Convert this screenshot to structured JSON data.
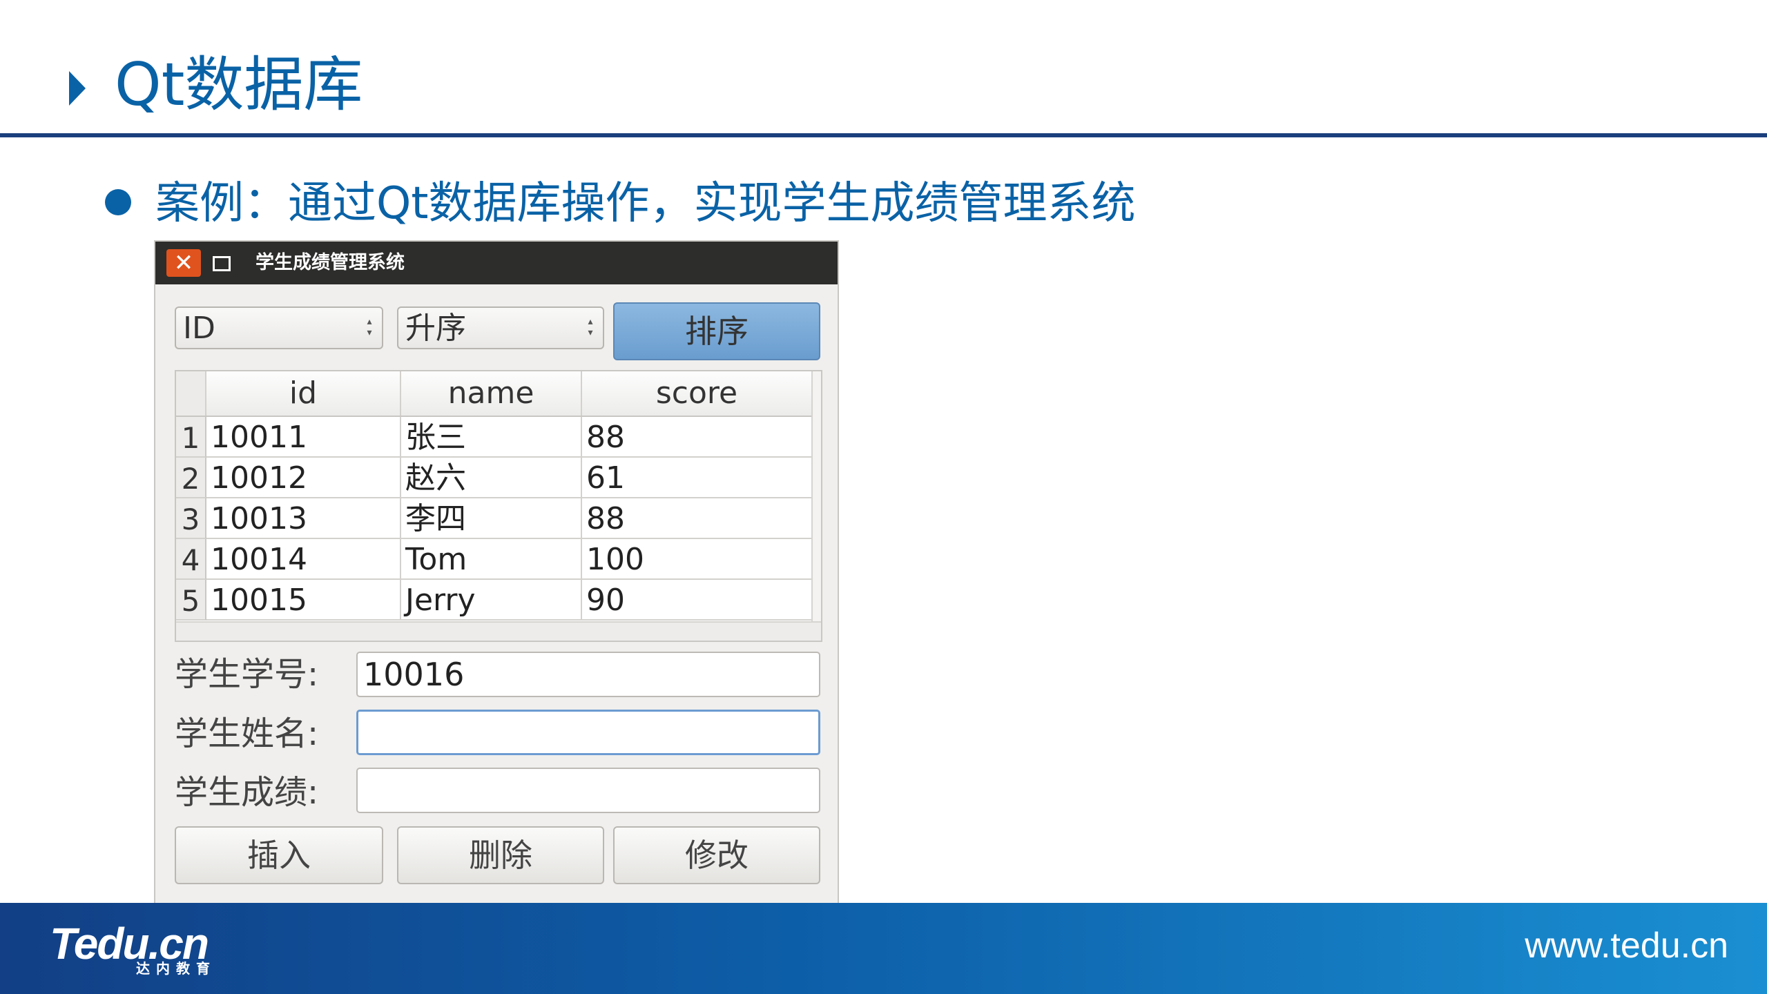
{
  "slide": {
    "title": "Qt数据库",
    "bullet": "案例：通过Qt数据库操作，实现学生成绩管理系统"
  },
  "window": {
    "title": "学生成绩管理系统",
    "close_glyph": "✕",
    "sort_field": "ID",
    "sort_order": "升序",
    "sort_button": "排序",
    "table": {
      "columns": [
        "id",
        "name",
        "score"
      ],
      "rows": [
        {
          "num": "1",
          "id": "10011",
          "name": "张三",
          "score": "88"
        },
        {
          "num": "2",
          "id": "10012",
          "name": "赵六",
          "score": "61"
        },
        {
          "num": "3",
          "id": "10013",
          "name": "李四",
          "score": "88"
        },
        {
          "num": "4",
          "id": "10014",
          "name": "Tom",
          "score": "100"
        },
        {
          "num": "5",
          "id": "10015",
          "name": "Jerry",
          "score": "90"
        }
      ]
    },
    "form": {
      "id_label": "学生学号:",
      "id_value": "10016",
      "name_label": "学生姓名:",
      "name_value": "",
      "score_label": "学生成绩:",
      "score_value": ""
    },
    "buttons": {
      "insert": "插入",
      "delete": "删除",
      "modify": "修改"
    }
  },
  "footer": {
    "logo": "Tedu.cn",
    "logo_sub": "达内教育",
    "url": "www.tedu.cn"
  },
  "colors": {
    "accent": "#0a62a6",
    "rule": "#1b3f7d",
    "close": "#e0531e"
  }
}
